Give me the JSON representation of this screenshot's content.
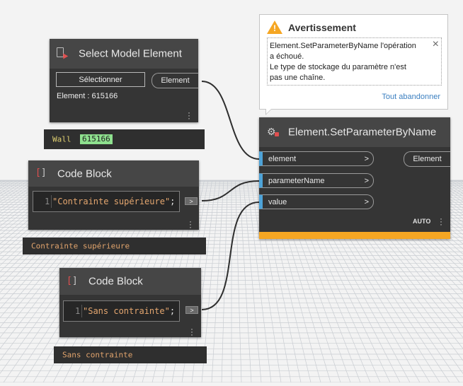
{
  "select_node": {
    "title": "Select Model Element",
    "select_button": "Sélectionner",
    "output_port": "Element",
    "element_info": "Element : 615166"
  },
  "select_preview": {
    "label": "Wall",
    "value": "615166"
  },
  "code_block_1": {
    "title": "Code Block",
    "line_no": "1",
    "code": "\"Contrainte supérieure\"",
    "semicolon": ";",
    "out": ">"
  },
  "code_block_1_preview": "Contrainte supérieure",
  "code_block_2": {
    "title": "Code Block",
    "line_no": "1",
    "code": "\"Sans contrainte\"",
    "semicolon": ";",
    "out": ">"
  },
  "code_block_2_preview": "Sans contrainte",
  "set_param_node": {
    "title": "Element.SetParameterByName",
    "inputs": [
      "element",
      "parameterName",
      "value"
    ],
    "chevron": ">",
    "output_port": "Element",
    "lacing": "AUTO"
  },
  "warning": {
    "title": "Avertissement",
    "message_lines": [
      "Element.SetParameterByName l'opération",
      "a échoué.",
      "Le type de stockage du paramètre n'est",
      "pas une chaîne."
    ],
    "dismiss_all": "Tout abandonner"
  },
  "colors": {
    "port_accent": "#4ea3d8",
    "warning_bar": "#f5a623",
    "preview_highlight": "#8ee08e",
    "link": "#3b7fc0"
  }
}
